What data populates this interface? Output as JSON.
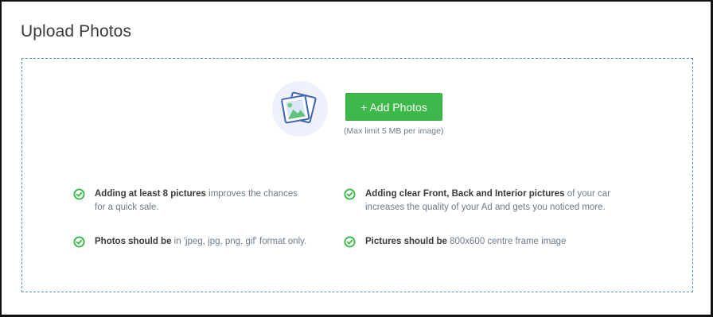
{
  "section": {
    "title": "Upload Photos"
  },
  "upload": {
    "button_label": "+ Add Photos",
    "limit_note": "(Max limit 5 MB per image)"
  },
  "tips": [
    {
      "bold": "Adding at least 8 pictures",
      "rest": " improves the chances",
      "line2": "for a quick sale."
    },
    {
      "bold": "Adding clear Front, Back and Interior pictures",
      "rest": " of your car",
      "line2": "increases the quality of your Ad and gets you noticed more."
    },
    {
      "bold": "Photos should be",
      "rest": " in 'jpeg, jpg, png, gif' format only.",
      "line2": ""
    },
    {
      "bold": "Pictures should be",
      "rest": " 800x600 centre frame image",
      "line2": ""
    }
  ],
  "colors": {
    "accent_green": "#3cb94a",
    "check_green": "#3cb94a",
    "dashed_border": "#5b8fb9",
    "icon_circle": "#eef0fb"
  },
  "icons": {
    "photo": "photos-icon",
    "check": "check-circle-icon"
  }
}
